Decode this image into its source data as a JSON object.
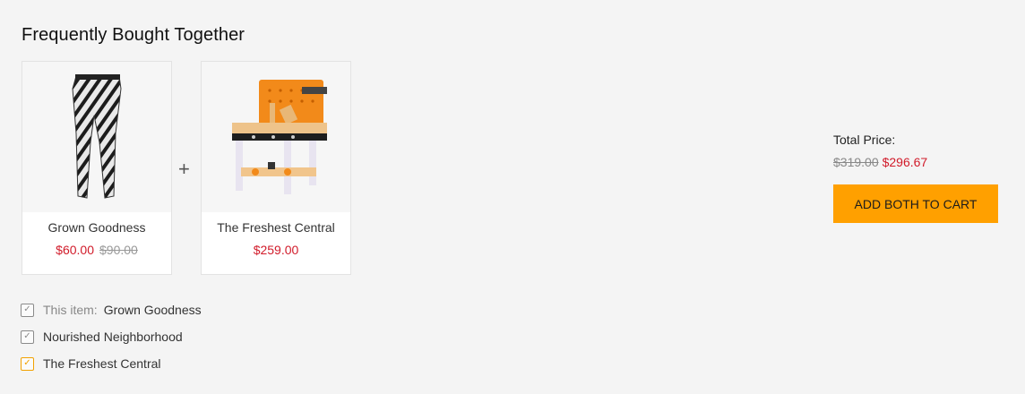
{
  "section": {
    "title": "Frequently Bought Together"
  },
  "products": [
    {
      "name": "Grown Goodness",
      "price": "$60.00",
      "old_price": "$90.00",
      "image_icon": "zebra-leggings-image"
    },
    {
      "name": "The Freshest Central",
      "price": "$259.00",
      "old_price": "",
      "image_icon": "toy-workbench-image"
    }
  ],
  "plus_symbol": "+",
  "checklist": [
    {
      "prefix": "This item:",
      "label": "Grown Goodness",
      "checked": true
    },
    {
      "label": "Nourished Neighborhood",
      "checked": true
    },
    {
      "label": "The Freshest Central",
      "checked": true
    }
  ],
  "total": {
    "label": "Total Price:",
    "old_price": "$319.00",
    "price": "$296.67"
  },
  "cart_button": {
    "label": "ADD BOTH TO CART"
  },
  "colors": {
    "accent": "#ffa000",
    "sale": "#d11b2a",
    "background": "#f4f4f4"
  }
}
